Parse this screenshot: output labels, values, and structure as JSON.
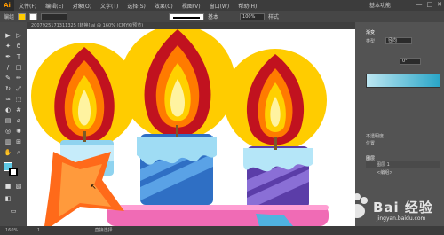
{
  "app": {
    "logo": "Ai",
    "workspace": "基本功能",
    "window_controls": [
      "—",
      "□",
      "✕"
    ]
  },
  "menu": [
    "文件(F)",
    "编辑(E)",
    "对象(O)",
    "文字(T)",
    "选择(S)",
    "效果(C)",
    "视图(V)",
    "窗口(W)",
    "帮助(H)"
  ],
  "control_bar": {
    "selection_label": "编组",
    "opacity_value": "100%",
    "style_label": "样式",
    "stroke_value": "基本"
  },
  "document_tab": "2007925171311325 [转换].ai @ 160% (CMYK/预览)",
  "panels": {
    "tab_gradient": "渐变",
    "tab_type": "类型",
    "type_value": "径向",
    "angle_value": "0°",
    "location_label": "不透明度",
    "location_label2": "位置",
    "layers_label": "图层",
    "layer_1": "图层 1",
    "layer_2": "<编组>"
  },
  "status": {
    "zoom": "160%",
    "page": "1",
    "mode": "直接选择"
  },
  "watermark": {
    "text": "Bai 经验",
    "url": "jingyan.baidu.com"
  },
  "colors": {
    "accent": "#ff9a00",
    "flame_outer": "#ffcc00",
    "flame_red": "#c1121f",
    "candle_blue": "#4a90d9",
    "candle_purple": "#5b3da8"
  }
}
